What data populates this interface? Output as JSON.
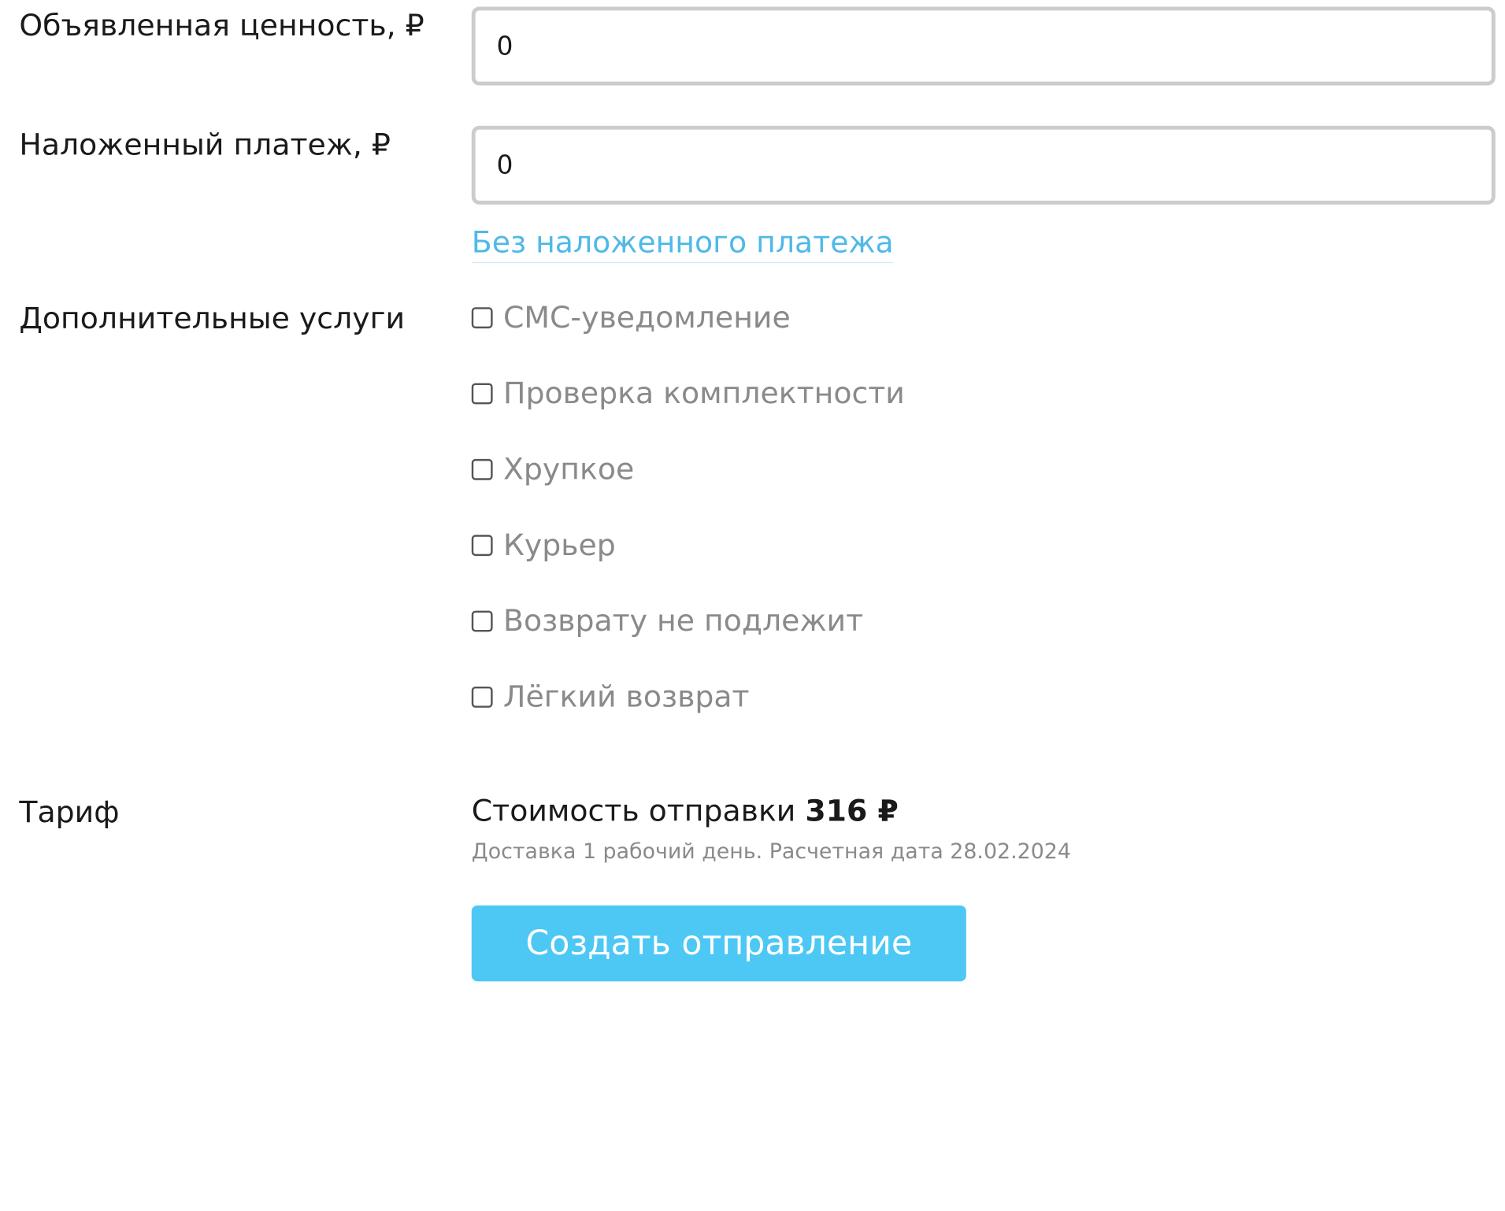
{
  "form": {
    "declared_value": {
      "label": "Объявленная ценность, ₽",
      "value": "0"
    },
    "cod_payment": {
      "label": "Наложенный платеж, ₽",
      "value": "0",
      "clear_link": "Без наложенного платежа"
    },
    "extra_services": {
      "label": "Дополнительные услуги",
      "options": [
        {
          "label": "СМС-уведомление",
          "checked": false
        },
        {
          "label": "Проверка комплектности",
          "checked": false
        },
        {
          "label": "Хрупкое",
          "checked": false
        },
        {
          "label": "Курьер",
          "checked": false
        },
        {
          "label": "Возврату не подлежит",
          "checked": false
        },
        {
          "label": "Лёгкий возврат",
          "checked": false
        }
      ]
    },
    "tariff": {
      "label": "Тариф",
      "price_prefix": "Стоимость отправки",
      "price_value": "316 ₽",
      "delivery_note": "Доставка 1 рабочий день. Расчетная дата 28.02.2024"
    },
    "submit_label": "Создать отправление"
  },
  "colors": {
    "link": "#4fb9e8",
    "button_bg": "#4dc8f5",
    "input_border": "#cccccc",
    "muted_text": "#8a8a8a"
  }
}
